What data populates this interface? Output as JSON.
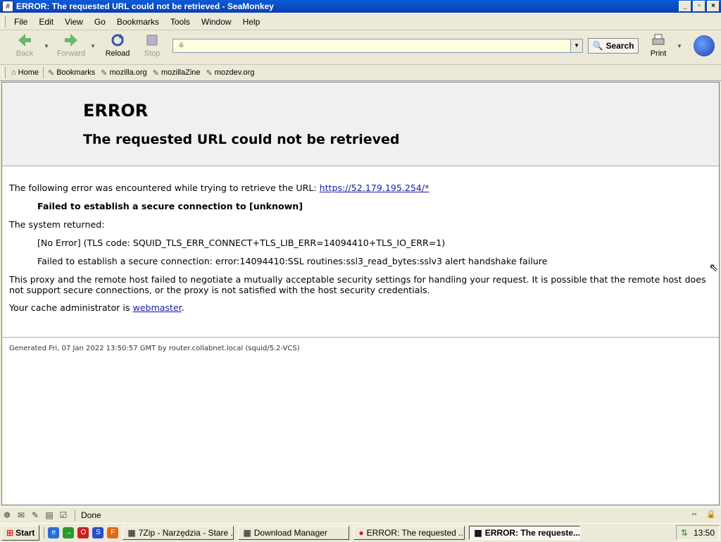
{
  "window": {
    "title": "ERROR: The requested URL could not be retrieved - SeaMonkey"
  },
  "menubar": [
    "File",
    "Edit",
    "View",
    "Go",
    "Bookmarks",
    "Tools",
    "Window",
    "Help"
  ],
  "nav": {
    "back": "Back",
    "forward": "Forward",
    "reload": "Reload",
    "stop": "Stop",
    "url_value": "",
    "search": "Search",
    "print": "Print"
  },
  "bookmarks": [
    "Home",
    "Bookmarks",
    "mozilla.org",
    "mozillaZine",
    "mozdev.org"
  ],
  "page": {
    "heading": "ERROR",
    "subheading": "The requested URL could not be retrieved",
    "intro": "The following error was encountered while trying to retrieve the URL: ",
    "url_link": "https://52.179.195.254/*",
    "failed": "Failed to establish a secure connection to [unknown]",
    "system_returned": "The system returned:",
    "no_error": "[No Error] (TLS code: SQUID_TLS_ERR_CONNECT+TLS_LIB_ERR=14094410+TLS_IO_ERR=1)",
    "ssl_detail": "Failed to establish a secure connection: error:14094410:SSL routines:ssl3_read_bytes:sslv3 alert handshake failure",
    "explanation": "This proxy and the remote host failed to negotiate a mutually acceptable security settings for handling your request. It is possible that the remote host does not support secure connections, or the proxy is not satisfied with the host security credentials.",
    "admin_prefix": "Your cache administrator is ",
    "admin_link": "webmaster",
    "admin_suffix": ".",
    "footer": "Generated Fri, 07 Jan 2022 13:50:57 GMT by router.collabnet.local (squid/5.2-VCS)"
  },
  "status": {
    "text": "Done"
  },
  "taskbar": {
    "start": "Start",
    "tasks": [
      "7Zip - Narzędzia - Stare ...",
      "Download Manager",
      "ERROR: The requested ...",
      "ERROR: The requeste..."
    ],
    "clock": "13:50"
  }
}
